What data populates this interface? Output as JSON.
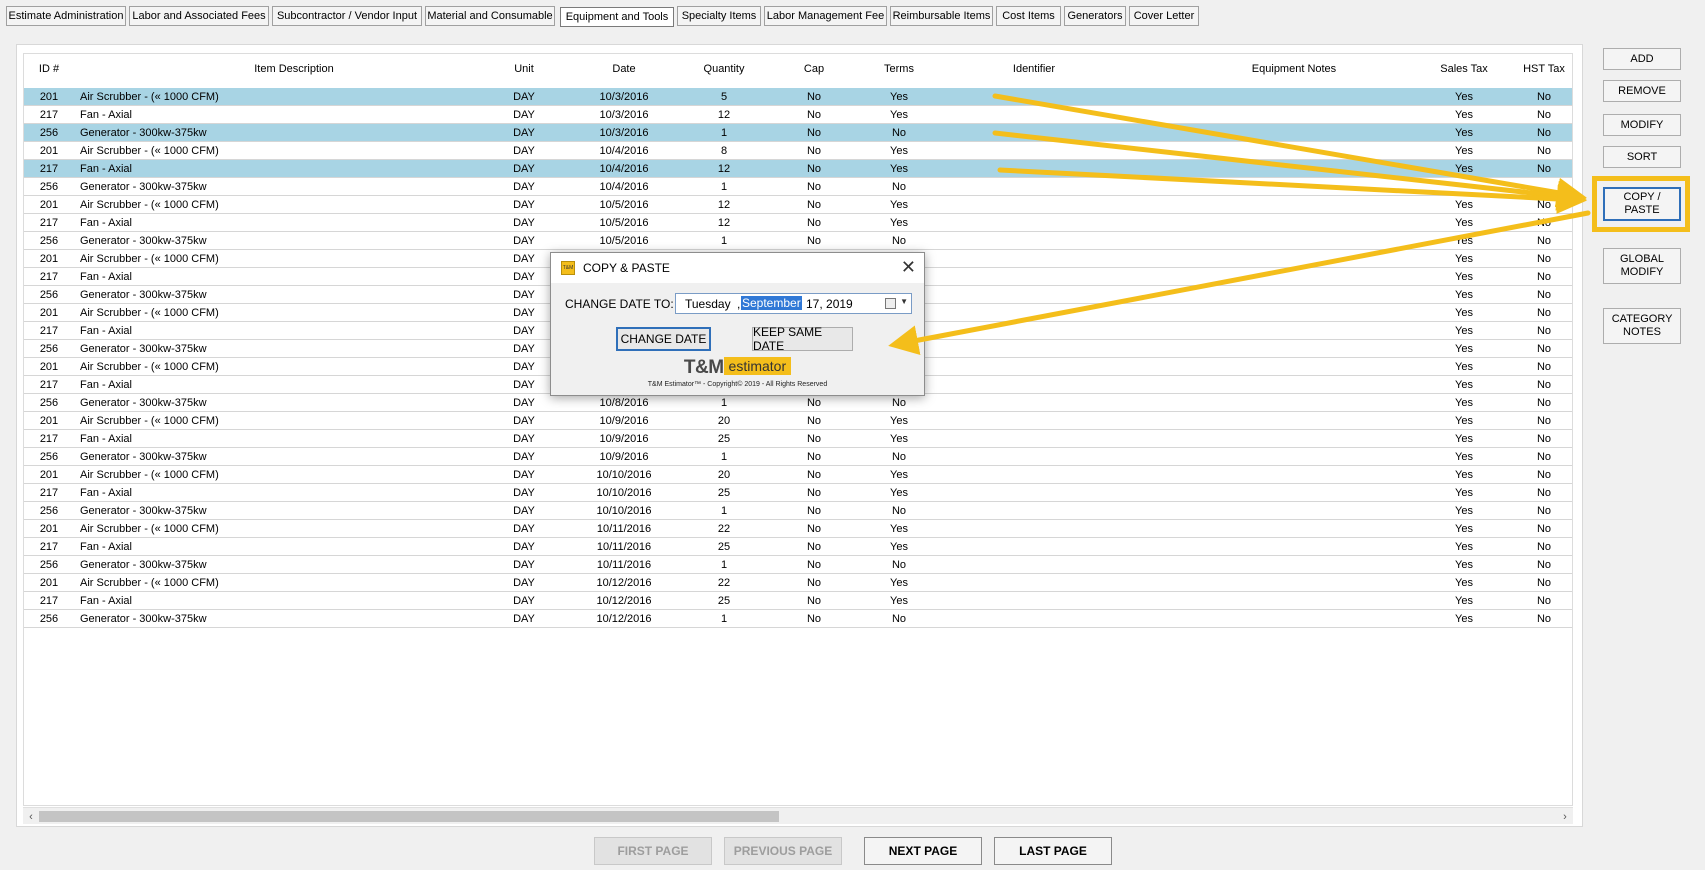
{
  "tabs": [
    {
      "label": "Estimate Administration",
      "active": false
    },
    {
      "label": "Labor and Associated Fees",
      "active": false
    },
    {
      "label": "Subcontractor / Vendor Input",
      "active": false
    },
    {
      "label": "Material and Consumable",
      "active": false
    },
    {
      "label": "Equipment and Tools",
      "active": true
    },
    {
      "label": "Specialty Items",
      "active": false
    },
    {
      "label": "Labor Management Fee",
      "active": false
    },
    {
      "label": "Reimbursable Items",
      "active": false
    },
    {
      "label": "Cost Items",
      "active": false
    },
    {
      "label": "Generators",
      "active": false
    },
    {
      "label": "Cover Letter",
      "active": false
    }
  ],
  "columns": {
    "id": "ID #",
    "description": "Item Description",
    "unit": "Unit",
    "date": "Date",
    "quantity": "Quantity",
    "cap": "Cap",
    "terms": "Terms",
    "identifier": "Identifier",
    "notes": "Equipment Notes",
    "sales_tax": "Sales Tax",
    "hst_tax": "HST Tax"
  },
  "rows": [
    {
      "id": "201",
      "desc": "Air Scrubber - (« 1000 CFM)",
      "unit": "DAY",
      "date": "10/3/2016",
      "qty": "5",
      "cap": "No",
      "terms": "Yes",
      "sales": "Yes",
      "hst": "No",
      "selected": true
    },
    {
      "id": "217",
      "desc": "Fan - Axial",
      "unit": "DAY",
      "date": "10/3/2016",
      "qty": "12",
      "cap": "No",
      "terms": "Yes",
      "sales": "Yes",
      "hst": "No",
      "selected": false
    },
    {
      "id": "256",
      "desc": "Generator - 300kw-375kw",
      "unit": "DAY",
      "date": "10/3/2016",
      "qty": "1",
      "cap": "No",
      "terms": "No",
      "sales": "Yes",
      "hst": "No",
      "selected": true
    },
    {
      "id": "201",
      "desc": "Air Scrubber - (« 1000 CFM)",
      "unit": "DAY",
      "date": "10/4/2016",
      "qty": "8",
      "cap": "No",
      "terms": "Yes",
      "sales": "Yes",
      "hst": "No",
      "selected": false
    },
    {
      "id": "217",
      "desc": "Fan - Axial",
      "unit": "DAY",
      "date": "10/4/2016",
      "qty": "12",
      "cap": "No",
      "terms": "Yes",
      "sales": "Yes",
      "hst": "No",
      "selected": true
    },
    {
      "id": "256",
      "desc": "Generator - 300kw-375kw",
      "unit": "DAY",
      "date": "10/4/2016",
      "qty": "1",
      "cap": "No",
      "terms": "No",
      "sales": "",
      "hst": "",
      "selected": false
    },
    {
      "id": "201",
      "desc": "Air Scrubber - (« 1000 CFM)",
      "unit": "DAY",
      "date": "10/5/2016",
      "qty": "12",
      "cap": "No",
      "terms": "Yes",
      "sales": "Yes",
      "hst": "No",
      "selected": false
    },
    {
      "id": "217",
      "desc": "Fan - Axial",
      "unit": "DAY",
      "date": "10/5/2016",
      "qty": "12",
      "cap": "No",
      "terms": "Yes",
      "sales": "Yes",
      "hst": "No",
      "selected": false
    },
    {
      "id": "256",
      "desc": "Generator - 300kw-375kw",
      "unit": "DAY",
      "date": "10/5/2016",
      "qty": "1",
      "cap": "No",
      "terms": "No",
      "sales": "Yes",
      "hst": "No",
      "selected": false
    },
    {
      "id": "201",
      "desc": "Air Scrubber - (« 1000 CFM)",
      "unit": "DAY",
      "date": "",
      "qty": "",
      "cap": "",
      "terms": "",
      "sales": "Yes",
      "hst": "No",
      "selected": false
    },
    {
      "id": "217",
      "desc": "Fan - Axial",
      "unit": "DAY",
      "date": "",
      "qty": "",
      "cap": "",
      "terms": "",
      "sales": "Yes",
      "hst": "No",
      "selected": false
    },
    {
      "id": "256",
      "desc": "Generator - 300kw-375kw",
      "unit": "DAY",
      "date": "",
      "qty": "",
      "cap": "",
      "terms": "",
      "sales": "Yes",
      "hst": "No",
      "selected": false
    },
    {
      "id": "201",
      "desc": "Air Scrubber - (« 1000 CFM)",
      "unit": "DAY",
      "date": "",
      "qty": "",
      "cap": "",
      "terms": "",
      "sales": "Yes",
      "hst": "No",
      "selected": false
    },
    {
      "id": "217",
      "desc": "Fan - Axial",
      "unit": "DAY",
      "date": "",
      "qty": "",
      "cap": "",
      "terms": "",
      "sales": "Yes",
      "hst": "No",
      "selected": false
    },
    {
      "id": "256",
      "desc": "Generator - 300kw-375kw",
      "unit": "DAY",
      "date": "",
      "qty": "",
      "cap": "",
      "terms": "",
      "sales": "Yes",
      "hst": "No",
      "selected": false
    },
    {
      "id": "201",
      "desc": "Air Scrubber - (« 1000 CFM)",
      "unit": "DAY",
      "date": "",
      "qty": "",
      "cap": "",
      "terms": "",
      "sales": "Yes",
      "hst": "No",
      "selected": false
    },
    {
      "id": "217",
      "desc": "Fan - Axial",
      "unit": "DAY",
      "date": "",
      "qty": "",
      "cap": "",
      "terms": "",
      "sales": "Yes",
      "hst": "No",
      "selected": false
    },
    {
      "id": "256",
      "desc": "Generator - 300kw-375kw",
      "unit": "DAY",
      "date": "10/8/2016",
      "qty": "1",
      "cap": "No",
      "terms": "No",
      "sales": "Yes",
      "hst": "No",
      "selected": false
    },
    {
      "id": "201",
      "desc": "Air Scrubber - (« 1000 CFM)",
      "unit": "DAY",
      "date": "10/9/2016",
      "qty": "20",
      "cap": "No",
      "terms": "Yes",
      "sales": "Yes",
      "hst": "No",
      "selected": false
    },
    {
      "id": "217",
      "desc": "Fan - Axial",
      "unit": "DAY",
      "date": "10/9/2016",
      "qty": "25",
      "cap": "No",
      "terms": "Yes",
      "sales": "Yes",
      "hst": "No",
      "selected": false
    },
    {
      "id": "256",
      "desc": "Generator - 300kw-375kw",
      "unit": "DAY",
      "date": "10/9/2016",
      "qty": "1",
      "cap": "No",
      "terms": "No",
      "sales": "Yes",
      "hst": "No",
      "selected": false
    },
    {
      "id": "201",
      "desc": "Air Scrubber - (« 1000 CFM)",
      "unit": "DAY",
      "date": "10/10/2016",
      "qty": "20",
      "cap": "No",
      "terms": "Yes",
      "sales": "Yes",
      "hst": "No",
      "selected": false
    },
    {
      "id": "217",
      "desc": "Fan - Axial",
      "unit": "DAY",
      "date": "10/10/2016",
      "qty": "25",
      "cap": "No",
      "terms": "Yes",
      "sales": "Yes",
      "hst": "No",
      "selected": false
    },
    {
      "id": "256",
      "desc": "Generator - 300kw-375kw",
      "unit": "DAY",
      "date": "10/10/2016",
      "qty": "1",
      "cap": "No",
      "terms": "No",
      "sales": "Yes",
      "hst": "No",
      "selected": false
    },
    {
      "id": "201",
      "desc": "Air Scrubber - (« 1000 CFM)",
      "unit": "DAY",
      "date": "10/11/2016",
      "qty": "22",
      "cap": "No",
      "terms": "Yes",
      "sales": "Yes",
      "hst": "No",
      "selected": false
    },
    {
      "id": "217",
      "desc": "Fan - Axial",
      "unit": "DAY",
      "date": "10/11/2016",
      "qty": "25",
      "cap": "No",
      "terms": "Yes",
      "sales": "Yes",
      "hst": "No",
      "selected": false
    },
    {
      "id": "256",
      "desc": "Generator - 300kw-375kw",
      "unit": "DAY",
      "date": "10/11/2016",
      "qty": "1",
      "cap": "No",
      "terms": "No",
      "sales": "Yes",
      "hst": "No",
      "selected": false
    },
    {
      "id": "201",
      "desc": "Air Scrubber - (« 1000 CFM)",
      "unit": "DAY",
      "date": "10/12/2016",
      "qty": "22",
      "cap": "No",
      "terms": "Yes",
      "sales": "Yes",
      "hst": "No",
      "selected": false
    },
    {
      "id": "217",
      "desc": "Fan - Axial",
      "unit": "DAY",
      "date": "10/12/2016",
      "qty": "25",
      "cap": "No",
      "terms": "Yes",
      "sales": "Yes",
      "hst": "No",
      "selected": false
    },
    {
      "id": "256",
      "desc": "Generator - 300kw-375kw",
      "unit": "DAY",
      "date": "10/12/2016",
      "qty": "1",
      "cap": "No",
      "terms": "No",
      "sales": "Yes",
      "hst": "No",
      "selected": false
    }
  ],
  "side_buttons": {
    "add": "ADD",
    "remove": "REMOVE",
    "modify": "MODIFY",
    "sort": "SORT",
    "copy_paste": "COPY / PASTE",
    "global_modify": "GLOBAL MODIFY",
    "category_notes": "CATEGORY NOTES"
  },
  "pager": {
    "first": "FIRST PAGE",
    "previous": "PREVIOUS PAGE",
    "next": "NEXT PAGE",
    "last": "LAST PAGE"
  },
  "dialog": {
    "icon_text": "T&M",
    "title": "COPY & PASTE",
    "close": "✕",
    "change_date_label": "CHANGE DATE TO:",
    "date_day": "Tuesday",
    "date_comma": ",",
    "date_month": "September",
    "date_rest": "17, 2019",
    "change_date_button": "CHANGE DATE",
    "keep_same_date_button": "KEEP SAME DATE",
    "brand_main": "T&M",
    "brand_sub": "estimator",
    "copyright": "T&M Estimator™ - Copyright© 2019 - All Rights Reserved"
  },
  "scroll": {
    "left_arrow": "‹",
    "right_arrow": "›"
  },
  "colors": {
    "selection": "#a8d4e4",
    "annotation_yellow": "#f4be1b",
    "focus_blue": "#2f6fb9"
  }
}
